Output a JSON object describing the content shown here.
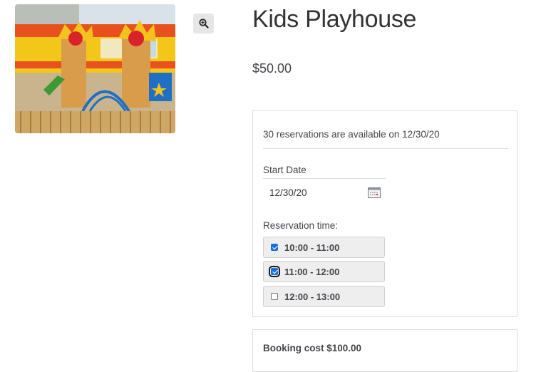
{
  "product": {
    "title": "Kids Playhouse",
    "price": "$50.00",
    "image_alt": "Colorful children's playground in front of a yellow and orange building"
  },
  "icons": {
    "zoom": "zoom-in-icon",
    "calendar": "calendar-icon"
  },
  "booking": {
    "availability_text": "30 reservations are available on 12/30/20",
    "start_date_label": "Start Date",
    "start_date_value": "12/30/20",
    "reservation_time_label": "Reservation time:",
    "slots": [
      {
        "label": "10:00 - 11:00",
        "checked": true
      },
      {
        "label": "11:00 - 12:00",
        "checked": true
      },
      {
        "label": "12:00 - 13:00",
        "checked": false
      }
    ],
    "cost_text": "Booking cost $100.00"
  },
  "colors": {
    "checkbox_accent": "#1a6fd6",
    "text": "#43454b",
    "border": "#dcdcdc"
  }
}
